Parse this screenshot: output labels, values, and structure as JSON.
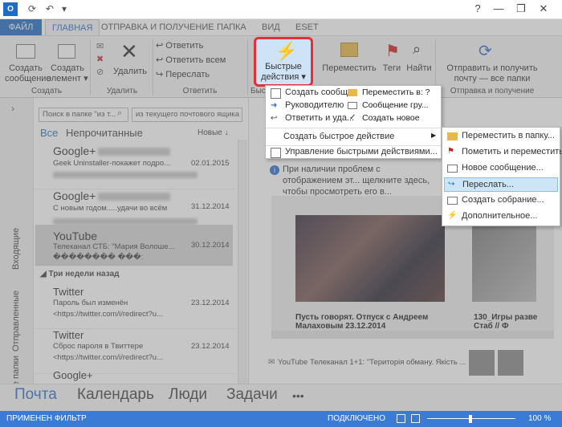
{
  "title": {
    "help": "?",
    "minimize": "—",
    "restore": "❐",
    "close": "✕"
  },
  "tabs": [
    "ФАЙЛ",
    "ГЛАВНАЯ",
    "ОТПРАВКА И ПОЛУЧЕНИЕ",
    "ПАПКА",
    "ВИД",
    "ESET"
  ],
  "ribbon": {
    "new_email": "Создать\nсообщение",
    "new_items": "Создать\nэлемент ▾",
    "group_create": "Создать",
    "delete": "Удалить",
    "group_delete": "Удалить",
    "reply": "Ответить",
    "reply_all": "Ответить всем",
    "forward": "Переслать",
    "group_reply": "Ответить",
    "quick_steps": "Быстрые\nдействия ▾",
    "group_quick": "Быс",
    "qs_items": [
      "Переместить в: ?",
      "Сообщение гру...",
      "Создать новое"
    ],
    "qs_left": [
      "Создать сообщ...",
      "Руководителю",
      "Ответить и уда..."
    ],
    "move": "Переместить",
    "tags": "Теги",
    "find": "Найти",
    "send_receive": "Отправить и получить\nпочту — все папки",
    "group_send": "Отправка и получение"
  },
  "search": {
    "placeholder": "Поиск в папке \"из т...",
    "scope": "из текущего почтового ящика"
  },
  "filter": {
    "all": "Все",
    "unread": "Непрочитанные",
    "sort": "Новые ↓"
  },
  "nav_vertical": [
    "Входящие",
    "Отправленные",
    "Все папки"
  ],
  "mails": [
    {
      "sender": "Google+",
      "preview": "Geek Uninstaller-покажет подро...",
      "preview2": "",
      "date": "02.01.2015"
    },
    {
      "sender": "Google+",
      "preview": "С новым годом.....удачи во всём",
      "preview2": "",
      "date": "31.12.2014"
    },
    {
      "sender": "YouTube",
      "preview": "Телеканал СТБ: \"Мария Волоше...",
      "preview2": "�������� ���:",
      "date": "30.12.2014"
    },
    {
      "sender": "Twitter",
      "preview": "Пароль был изменён",
      "preview2": "<https://twitter.com/i/redirect?u...",
      "date": "23.12.2014"
    },
    {
      "sender": "Twitter",
      "preview": "Сброс пароля в Твиттере",
      "preview2": "<https://twitter.com/i/redirect?u...",
      "date": "23.12.2014"
    },
    {
      "sender": "Google+",
      "preview": "",
      "preview2": "",
      "date": ""
    }
  ],
  "week_header": "◢ Три недели назад",
  "reading": {
    "infobar": "При наличии проблем с отображением эт... щелкните здесь, чтобы просмотреть его в...",
    "caption1": "Пусть говорят. Отпуск с Андреем\nМалаховым 23.12.2014",
    "caption2": "130_Игры разве\nСтаб // Ф",
    "footer": "YouTube Телеканал 1+1: \"Територія обману. Якість ..."
  },
  "dropdown": {
    "create": "Создать быстрое действие",
    "manage": "Управление быстрыми действиями..."
  },
  "submenu": [
    "Переместить в папку...",
    "Пометить и переместить...",
    "Новое сообщение...",
    "Переслать...",
    "Создать собрание...",
    "Дополнительное..."
  ],
  "bottom_nav": [
    "Почта",
    "Календарь",
    "Люди",
    "Задачи",
    "•••"
  ],
  "status": {
    "filter": "ПРИМЕНЕН ФИЛЬТР",
    "connected": "ПОДКЛЮЧЕНО",
    "zoom": "100 %"
  },
  "colors": {
    "accent": "#2b6fce",
    "highlight": "#e0303a",
    "status": "#3a7bd5"
  }
}
